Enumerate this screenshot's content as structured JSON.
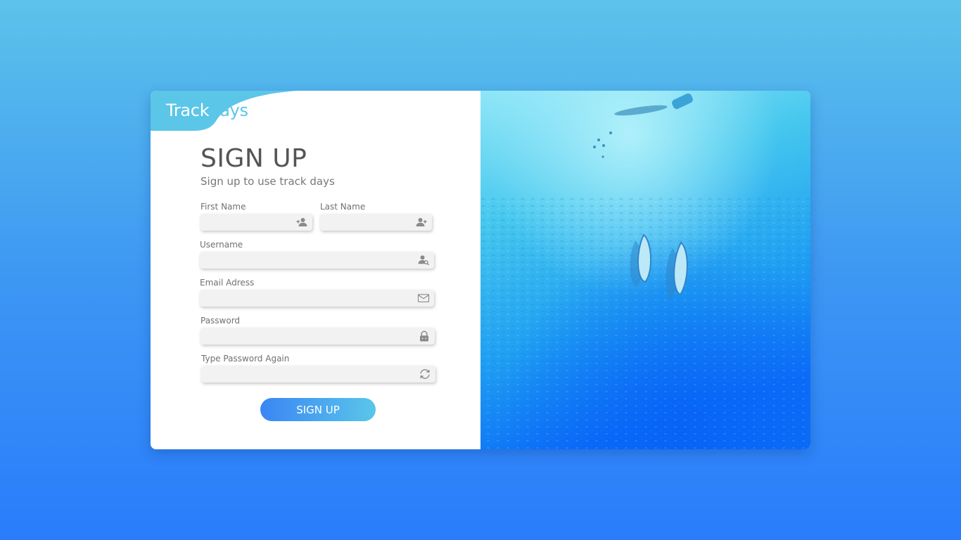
{
  "logo": {
    "part1": "Track",
    "part2": "days"
  },
  "form": {
    "title": "SIGN UP",
    "subtitle": "Sign up to use track days",
    "fields": {
      "first_name": {
        "label": "First Name",
        "value": "",
        "icon": "add-user-icon"
      },
      "last_name": {
        "label": "Last Name",
        "value": "",
        "icon": "add-user-icon"
      },
      "username": {
        "label": "Username",
        "value": "",
        "icon": "user-search-icon"
      },
      "email": {
        "label": "Email Adress",
        "value": "",
        "icon": "envelope-icon"
      },
      "password": {
        "label": "Password",
        "value": "",
        "icon": "lock-icon"
      },
      "password_again": {
        "label": "Type Password Again",
        "value": "",
        "icon": "refresh-icon"
      }
    },
    "submit_label": "SIGN UP"
  },
  "colors": {
    "accent_light": "#5bc6e8",
    "accent_dark": "#3a86f4",
    "background_top": "#5cc3ea",
    "background_bottom": "#2a7cfb"
  },
  "image": {
    "subject": "aerial-sea-with-boats"
  }
}
